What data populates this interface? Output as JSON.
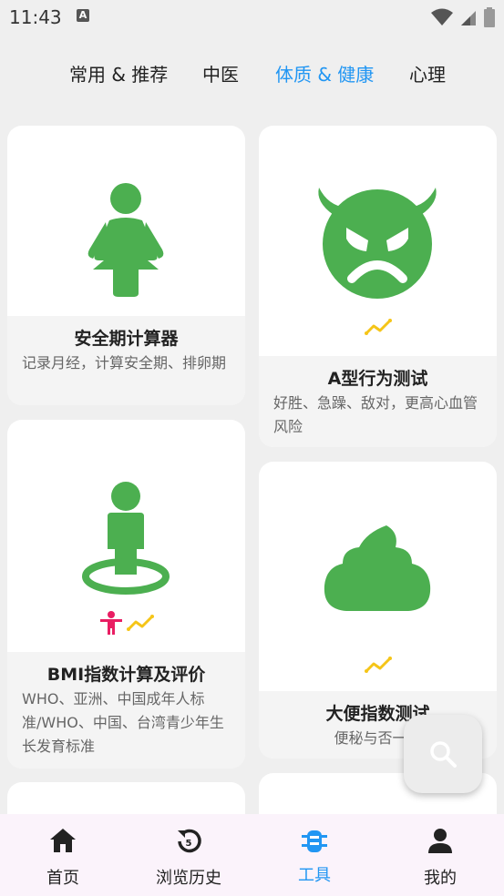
{
  "status": {
    "time": "11:43",
    "notif_glyph": "A"
  },
  "tabs": [
    {
      "label": "常用 & 推荐"
    },
    {
      "label": "中医"
    },
    {
      "label": "体质 & 健康",
      "active": true
    },
    {
      "label": "心理"
    }
  ],
  "cards": {
    "safe_period": {
      "title": "安全期计算器",
      "desc": "记录月经，计算安全期、排卵期"
    },
    "type_a": {
      "title": "A型行为测试",
      "desc": "好胜、急躁、敌对，更高心血管风险"
    },
    "bmi": {
      "title": "BMI指数计算及评价",
      "desc": "WHO、亚洲、中国成年人标准/WHO、中国、台湾青少年生长发育标准"
    },
    "stool": {
      "title": "大便指数测试",
      "desc": "便秘与否一测"
    }
  },
  "nav": [
    {
      "label": "首页",
      "icon": "home-icon"
    },
    {
      "label": "浏览历史",
      "icon": "history-icon"
    },
    {
      "label": "工具",
      "icon": "tools-icon",
      "active": true
    },
    {
      "label": "我的",
      "icon": "person-icon"
    }
  ],
  "colors": {
    "accent": "#2196f3",
    "green": "#4caf50",
    "trend": "#f5c518",
    "pink": "#e91e63"
  }
}
